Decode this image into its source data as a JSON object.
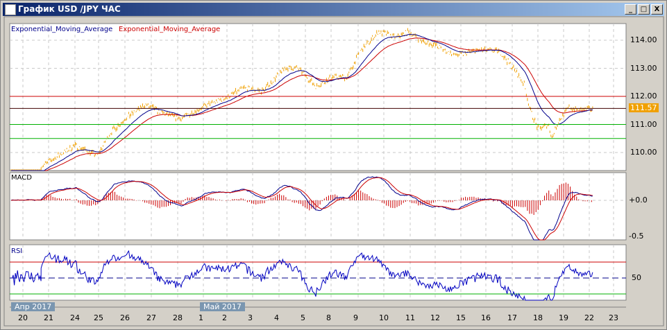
{
  "window": {
    "title": "График USD /JPY  ЧАС",
    "minimize": "_",
    "maximize": "□",
    "close": "X"
  },
  "legend": {
    "ema1": "Exponential_Moving_Average",
    "ema2": "Exponential_Moving_Average"
  },
  "colors": {
    "price": "#f0a000",
    "ema_fast": "#00008b",
    "ema_slow": "#cc0000",
    "support": "#00b000",
    "resistance": "#cc0000"
  },
  "panels": {
    "macd": "MACD",
    "rsi": "RSI"
  },
  "chart_data": {
    "type": "line",
    "price_axis": {
      "ticks": [
        "114.00",
        "113.00",
        "112.00",
        "111.00",
        "110.00"
      ],
      "current": "111.57"
    },
    "macd_axis": {
      "ticks": [
        "+0.0",
        "-0.5"
      ]
    },
    "rsi_axis": {
      "ticks": [
        "50"
      ],
      "levels": [
        70,
        30
      ]
    },
    "hlines": [
      {
        "value": 112.0,
        "color": "#cc0000"
      },
      {
        "value": 111.57,
        "color": "#400000"
      },
      {
        "value": 111.0,
        "color": "#00b000"
      },
      {
        "value": 110.5,
        "color": "#00b000"
      }
    ],
    "month_labels": [
      "Апр 2017",
      "Май 2017"
    ],
    "x_ticks": [
      "20",
      "21",
      "24",
      "25",
      "26",
      "27",
      "28",
      "1",
      "2",
      "3",
      "4",
      "5",
      "8",
      "9",
      "10",
      "11",
      "12",
      "15",
      "16",
      "17",
      "18",
      "19",
      "22",
      "23"
    ],
    "price": [
      [
        "04-20 17",
        109.5
      ],
      [
        "04-24 00",
        110.25
      ],
      [
        "04-24 21",
        109.9
      ],
      [
        "04-25 11",
        110.7
      ],
      [
        "04-26 00",
        111.2
      ],
      [
        "04-26 19",
        111.7
      ],
      [
        "04-27 14",
        111.35
      ],
      [
        "04-28 03",
        111.2
      ],
      [
        "04-28 22",
        111.6
      ],
      [
        "05-02 02",
        112.0
      ],
      [
        "05-02 15",
        112.3
      ],
      [
        "05-03 10",
        112.2
      ],
      [
        "05-04 05",
        113.0
      ],
      [
        "05-04 18",
        113.0
      ],
      [
        "05-05 10",
        112.35
      ],
      [
        "05-08 02",
        112.7
      ],
      [
        "05-08 15",
        112.7
      ],
      [
        "05-09 02",
        113.6
      ],
      [
        "05-09 19",
        114.3
      ],
      [
        "05-10 11",
        114.1
      ],
      [
        "05-10 23",
        114.3
      ],
      [
        "05-11 12",
        113.95
      ],
      [
        "05-12 02",
        113.8
      ],
      [
        "05-12 18",
        113.45
      ],
      [
        "05-15 17",
        113.65
      ],
      [
        "05-16 13",
        113.6
      ],
      [
        "05-17 01",
        113.0
      ],
      [
        "05-17 11",
        112.45
      ],
      [
        "05-17 17",
        111.5
      ],
      [
        "05-18 00",
        110.85
      ],
      [
        "05-18 10",
        111.0
      ],
      [
        "05-18 13",
        110.5
      ],
      [
        "05-18 19",
        111.1
      ],
      [
        "05-19 05",
        111.6
      ],
      [
        "05-19 15",
        111.5
      ],
      [
        "05-22 04",
        111.57
      ]
    ]
  }
}
